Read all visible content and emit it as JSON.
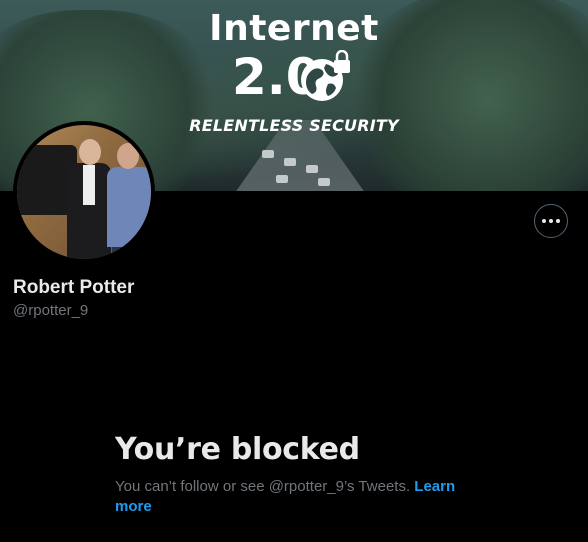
{
  "banner": {
    "title": "Internet",
    "version": "2.0",
    "tagline": "RELENTLESS SECURITY"
  },
  "profile": {
    "name": "Robert Potter",
    "handle": "@rpotter_9",
    "more_icon": "more-horizontal-icon"
  },
  "blocked": {
    "title": "You’re blocked",
    "message": "You can’t follow or see @rpotter_9’s Tweets.",
    "learn_more": "Learn more"
  },
  "colors": {
    "link": "#1d9bf0",
    "secondary_text": "#71767b",
    "background": "#000000"
  }
}
